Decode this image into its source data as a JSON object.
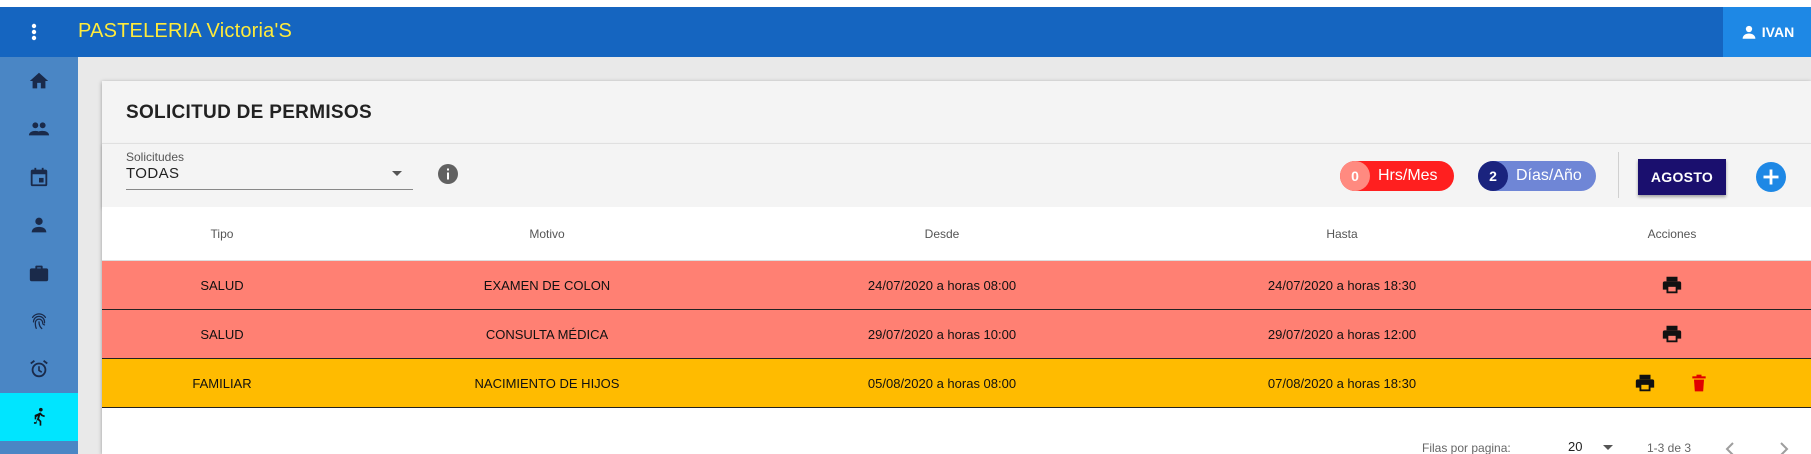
{
  "app": {
    "title": "PASTELERIA Victoria'S",
    "user": "IVAN"
  },
  "sidebar": {
    "items": [
      {
        "icon": "home-icon"
      },
      {
        "icon": "people-icon"
      },
      {
        "icon": "calendar-icon"
      },
      {
        "icon": "person-icon"
      },
      {
        "icon": "briefcase-icon"
      },
      {
        "icon": "fingerprint-icon"
      },
      {
        "icon": "alarm-icon"
      },
      {
        "icon": "running-person-icon",
        "active": true
      }
    ]
  },
  "page": {
    "title": "SOLICITUD DE PERMISOS"
  },
  "filter": {
    "label": "Solicitudes",
    "value": "TODAS"
  },
  "stats": {
    "hours": {
      "count": "0",
      "label": "Hrs/Mes"
    },
    "days": {
      "count": "2",
      "label": "Días/Año"
    }
  },
  "month_button": "AGOSTO",
  "table": {
    "headers": [
      "Tipo",
      "Motivo",
      "Desde",
      "Hasta",
      "Acciones"
    ],
    "rows": [
      {
        "tipo": "SALUD",
        "motivo": "EXAMEN DE COLON",
        "desde": "24/07/2020 a horas 08:00",
        "hasta": "24/07/2020 a horas 18:30",
        "color": "#ff8073",
        "actions": [
          "print"
        ]
      },
      {
        "tipo": "SALUD",
        "motivo": "CONSULTA MÉDICA",
        "desde": "29/07/2020 a horas 10:00",
        "hasta": "29/07/2020 a horas 12:00",
        "color": "#ff8073",
        "actions": [
          "print"
        ]
      },
      {
        "tipo": "FAMILIAR",
        "motivo": "NACIMIENTO DE HIJOS",
        "desde": "05/08/2020 a horas 08:00",
        "hasta": "07/08/2020 a horas 18:30",
        "color": "#ffbb00",
        "actions": [
          "print",
          "delete"
        ]
      }
    ]
  },
  "pagination": {
    "label": "Filas por pagina:",
    "page_size": "20",
    "range": "1-3 de 3"
  },
  "colors": {
    "appbar": "#1565c0",
    "title": "#ffeb3b",
    "sidebar": "#4a86c5",
    "active": "#00e5ff",
    "month_button": "#1a0f6e",
    "add": "#1e88e5",
    "delete": "#e00000"
  }
}
